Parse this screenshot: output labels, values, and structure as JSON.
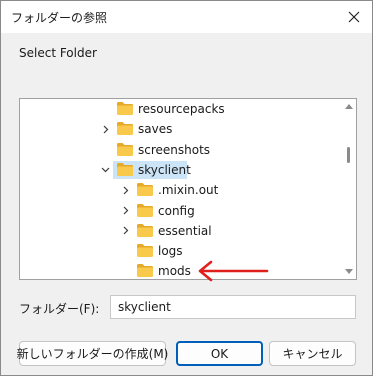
{
  "window": {
    "title": "フォルダーの参照",
    "close_symbol": "close-icon"
  },
  "dialog": {
    "prompt": "Select Folder"
  },
  "tree": {
    "items": [
      {
        "label": "resourcepacks",
        "has_children": false,
        "expanded": false,
        "selected": false,
        "level": 1
      },
      {
        "label": "saves",
        "has_children": true,
        "expanded": false,
        "selected": false,
        "level": 1
      },
      {
        "label": "screenshots",
        "has_children": false,
        "expanded": false,
        "selected": false,
        "level": 1
      },
      {
        "label": "skyclient",
        "has_children": true,
        "expanded": true,
        "selected": true,
        "level": 1
      },
      {
        "label": ".mixin.out",
        "has_children": true,
        "expanded": false,
        "selected": false,
        "level": 2
      },
      {
        "label": "config",
        "has_children": true,
        "expanded": false,
        "selected": false,
        "level": 2
      },
      {
        "label": "essential",
        "has_children": true,
        "expanded": false,
        "selected": false,
        "level": 2
      },
      {
        "label": "logs",
        "has_children": false,
        "expanded": false,
        "selected": false,
        "level": 2
      },
      {
        "label": "mods",
        "has_children": false,
        "expanded": false,
        "selected": false,
        "level": 2
      }
    ]
  },
  "folder_field": {
    "label": "フォルダー(F):",
    "value": "skyclient"
  },
  "buttons": {
    "new_folder": "新しいフォルダーの作成(M)",
    "ok": "OK",
    "cancel": "キャンセル"
  },
  "colors": {
    "folder_fill": "#f8c94a",
    "folder_tab": "#e6a92a",
    "selection": "#cce4f7",
    "ok_border": "#005fb8",
    "annotation_arrow": "#e0201c"
  }
}
